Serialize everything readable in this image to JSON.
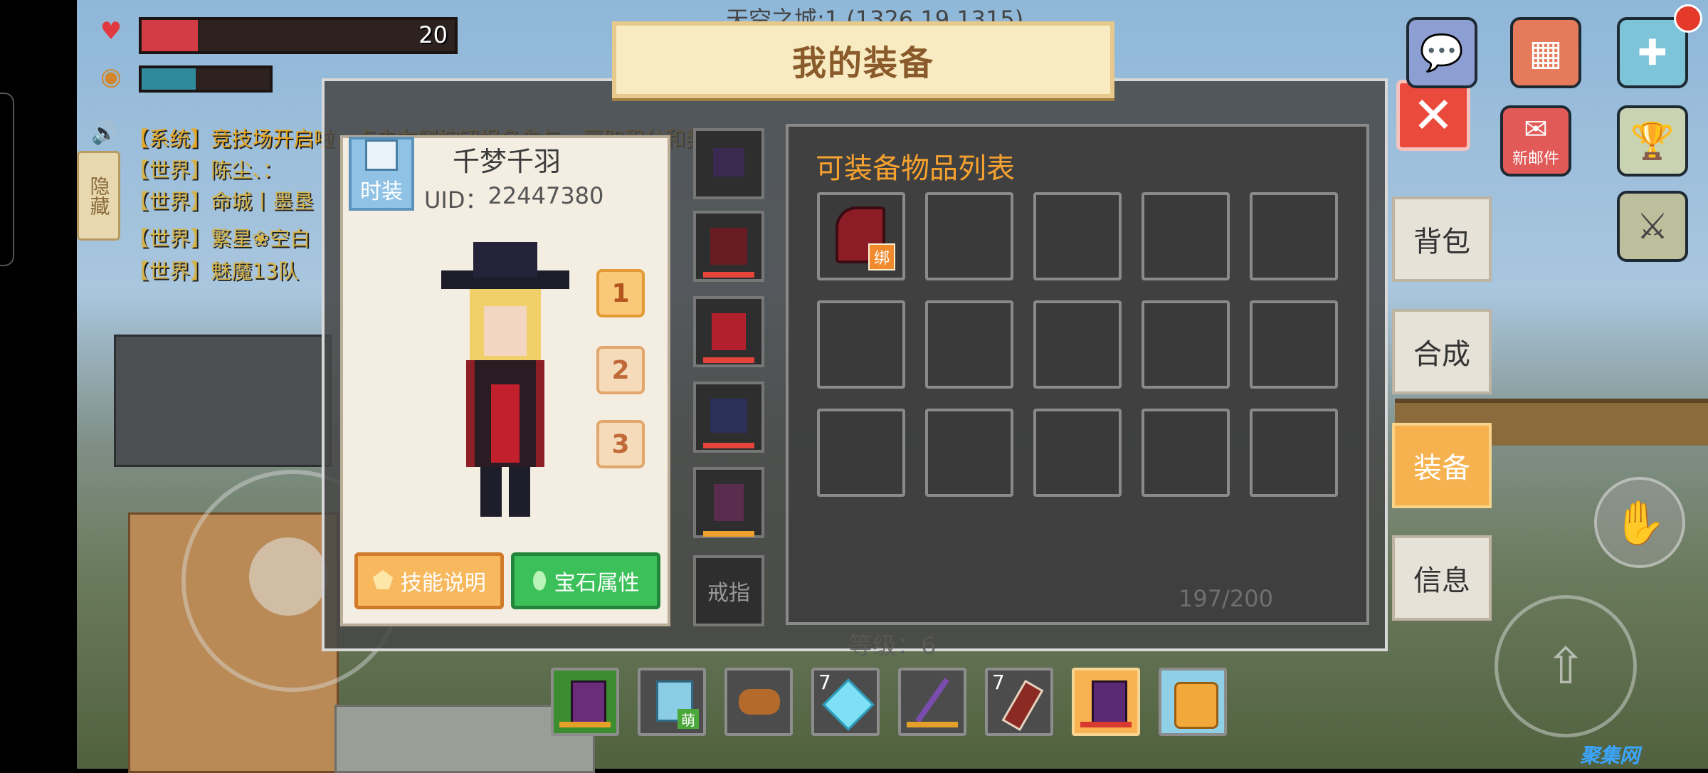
{
  "hud": {
    "health_value": "20",
    "health_fraction": 0.18,
    "hunger_fraction": 0.42,
    "location_text": "天空之城:1 (1326,19,1315)"
  },
  "chat": {
    "hide_button": "隐藏",
    "lines": [
      "【系统】竞技场开启啦，点击右侧按钮报名参与，赢取积分和奖励",
      "【世界】陈尘、：",
      "【世界】命城丨墨垦",
      "【世界】繁星❀空白",
      "【世界】魅魔13队"
    ]
  },
  "modal": {
    "title": "我的装备",
    "close_icon": "close-icon"
  },
  "character": {
    "costume_label": "时装",
    "name": "千梦千羽",
    "uid_label": "UID：",
    "uid_value": "22447380",
    "preset_buttons": [
      "1",
      "2",
      "3"
    ],
    "skill_button": "技能说明",
    "gem_button": "宝石属性",
    "ring_slot": "戒指",
    "level_text": "等级：6"
  },
  "equip_list": {
    "title": "可装备物品列表",
    "bound_badge": "绑",
    "count_text": "197/200"
  },
  "side_tabs": [
    "背包",
    "合成",
    "装备",
    "信息"
  ],
  "side_tabs_active": "装备",
  "top_right": {
    "mail_label": "新邮件"
  },
  "hotbar": {
    "counts": [
      "7",
      "7"
    ],
    "new_badge": "萌",
    "selected_index": 6
  },
  "watermark": "聚集网",
  "colors": {
    "accent_orange": "#f6b24f",
    "title_brown": "#8a5a2b",
    "list_title": "#f7a22e",
    "close_red": "#ea4a3c",
    "health_red": "#d33b45",
    "hunger_teal": "#2f8b9c"
  }
}
